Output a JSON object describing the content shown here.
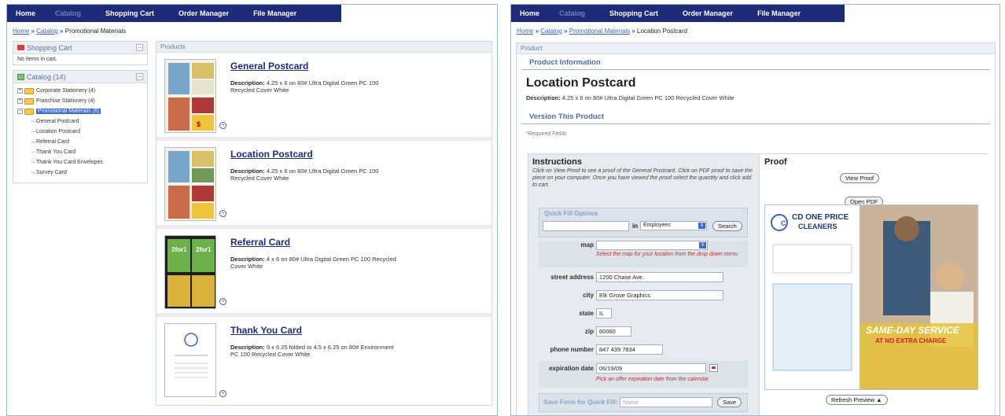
{
  "nav": {
    "items": [
      {
        "label": "Home",
        "dim": false
      },
      {
        "label": "Catalog",
        "dim": true
      },
      {
        "label": "Shopping Cart",
        "dim": false
      },
      {
        "label": "Order Manager",
        "dim": false
      },
      {
        "label": "File Manager",
        "dim": false
      }
    ]
  },
  "left": {
    "breadcrumb": {
      "home": "Home",
      "sep1": " » ",
      "catalog": "Catalog",
      "sep2": " » ",
      "current": "Promotional Materials"
    },
    "cart": {
      "title": "Shopping Cart",
      "empty_text": "No items in cart.",
      "min": "–"
    },
    "catalog": {
      "title": "Catalog (14)",
      "min": "–",
      "folders": [
        {
          "label": "Corporate Stationery (4)"
        },
        {
          "label": "Franchise Stationery (4)"
        },
        {
          "label": "Promotional Materials (6)"
        }
      ],
      "items": [
        {
          "label": "General Postcard"
        },
        {
          "label": "Location Postcard"
        },
        {
          "label": "Referral Card"
        },
        {
          "label": "Thank You Card"
        },
        {
          "label": "Thank You Card Envelopes"
        },
        {
          "label": "Survey Card"
        }
      ]
    },
    "products_header": "Products",
    "products": [
      {
        "title": "General Postcard",
        "desc_label": "Description:",
        "desc": "4.25 x 6 on 80# Ultra Digital Green PC 100 Recycled Cover White"
      },
      {
        "title": "Location Postcard",
        "desc_label": "Description:",
        "desc": "4.25 x 6 on 80# Ultra Digital Green PC 100 Recycled Cover White"
      },
      {
        "title": "Referral Card",
        "desc_label": "Description:",
        "desc": "4 x 6 on 80# Ultra Digital Green PC 100 Recycled Cover White"
      },
      {
        "title": "Thank You Card",
        "desc_label": "Description:",
        "desc": "9 x 6.25 folded to 4.5 x 6.25 on 80# Environment PC 100 Recycled Cover White"
      }
    ]
  },
  "right": {
    "breadcrumb": {
      "home": "Home",
      "sep1": " » ",
      "catalog": "Catalog",
      "sep2": " » ",
      "promo": "Promotional Materials",
      "sep3": " » ",
      "current": "Location Postcard"
    },
    "header": "Product",
    "product_info_title": "Product Information",
    "product_title": "Location Postcard",
    "desc_label": "Description:",
    "desc": "4.25 x 6 on 80# Ultra Digital Green PC 100 Recycled Cover White",
    "version_title": "Version This Product",
    "required_note": "*Required Fields",
    "instructions_title": "Instructions",
    "instructions_text": "Click on View Proof to see a proof of the General Postcard. Click on PDF proof to save the piece on your computer. Once you have viewed the proof select the quantity and click add to cart.",
    "quick_fill": {
      "label": "Quick Fill Options",
      "in_label": "in",
      "select_value": "Employees",
      "search_label": "Search"
    },
    "fields": {
      "map_label": "map",
      "map_hint": "Select the map for your location from the drop down menu",
      "street_label": "street address",
      "street_value": "1200 Chase Ave.",
      "city_label": "city",
      "city_value": "Elk Grove Graphics",
      "state_label": "state",
      "state_value": "IL",
      "zip_label": "zip",
      "zip_value": "60060",
      "phone_label": "phone number",
      "phone_value": "847 439 7834",
      "exp_label": "expiration date",
      "exp_value": "06/19/09",
      "exp_hint": "Pick an offer expiration date from the calendar"
    },
    "save_form": {
      "label": "Save Form for Quick Fill:",
      "placeholder": "Name",
      "button": "Save"
    },
    "proof": {
      "title": "Proof",
      "view_button": "View Proof",
      "pdf_button": "Open PDF",
      "refresh_button": "Refresh Preview ▲",
      "brand_line1": "CD ONE PRICE",
      "brand_line2": "CLEANERS",
      "promo_line1": "SAME-DAY SERVICE",
      "promo_line2": "AT NO EXTRA CHARGE"
    }
  }
}
